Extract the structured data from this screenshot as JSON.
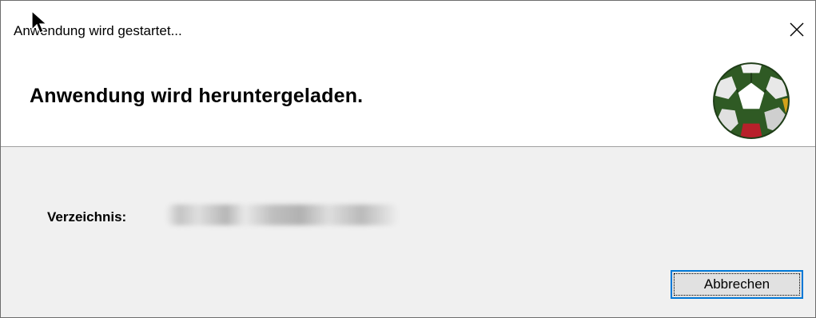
{
  "window": {
    "title": "Anwendung wird gestartet...",
    "close_icon": "close-icon"
  },
  "header": {
    "heading": "Anwendung wird heruntergeladen.",
    "app_icon": "soccer-ball-icon"
  },
  "content": {
    "directory_label": "Verzeichnis:",
    "directory_value": ""
  },
  "buttons": {
    "cancel_label": "Abbrechen"
  },
  "colors": {
    "focus_accent": "#0078d7",
    "window_bg": "#f0f0f0",
    "header_bg": "#ffffff"
  }
}
